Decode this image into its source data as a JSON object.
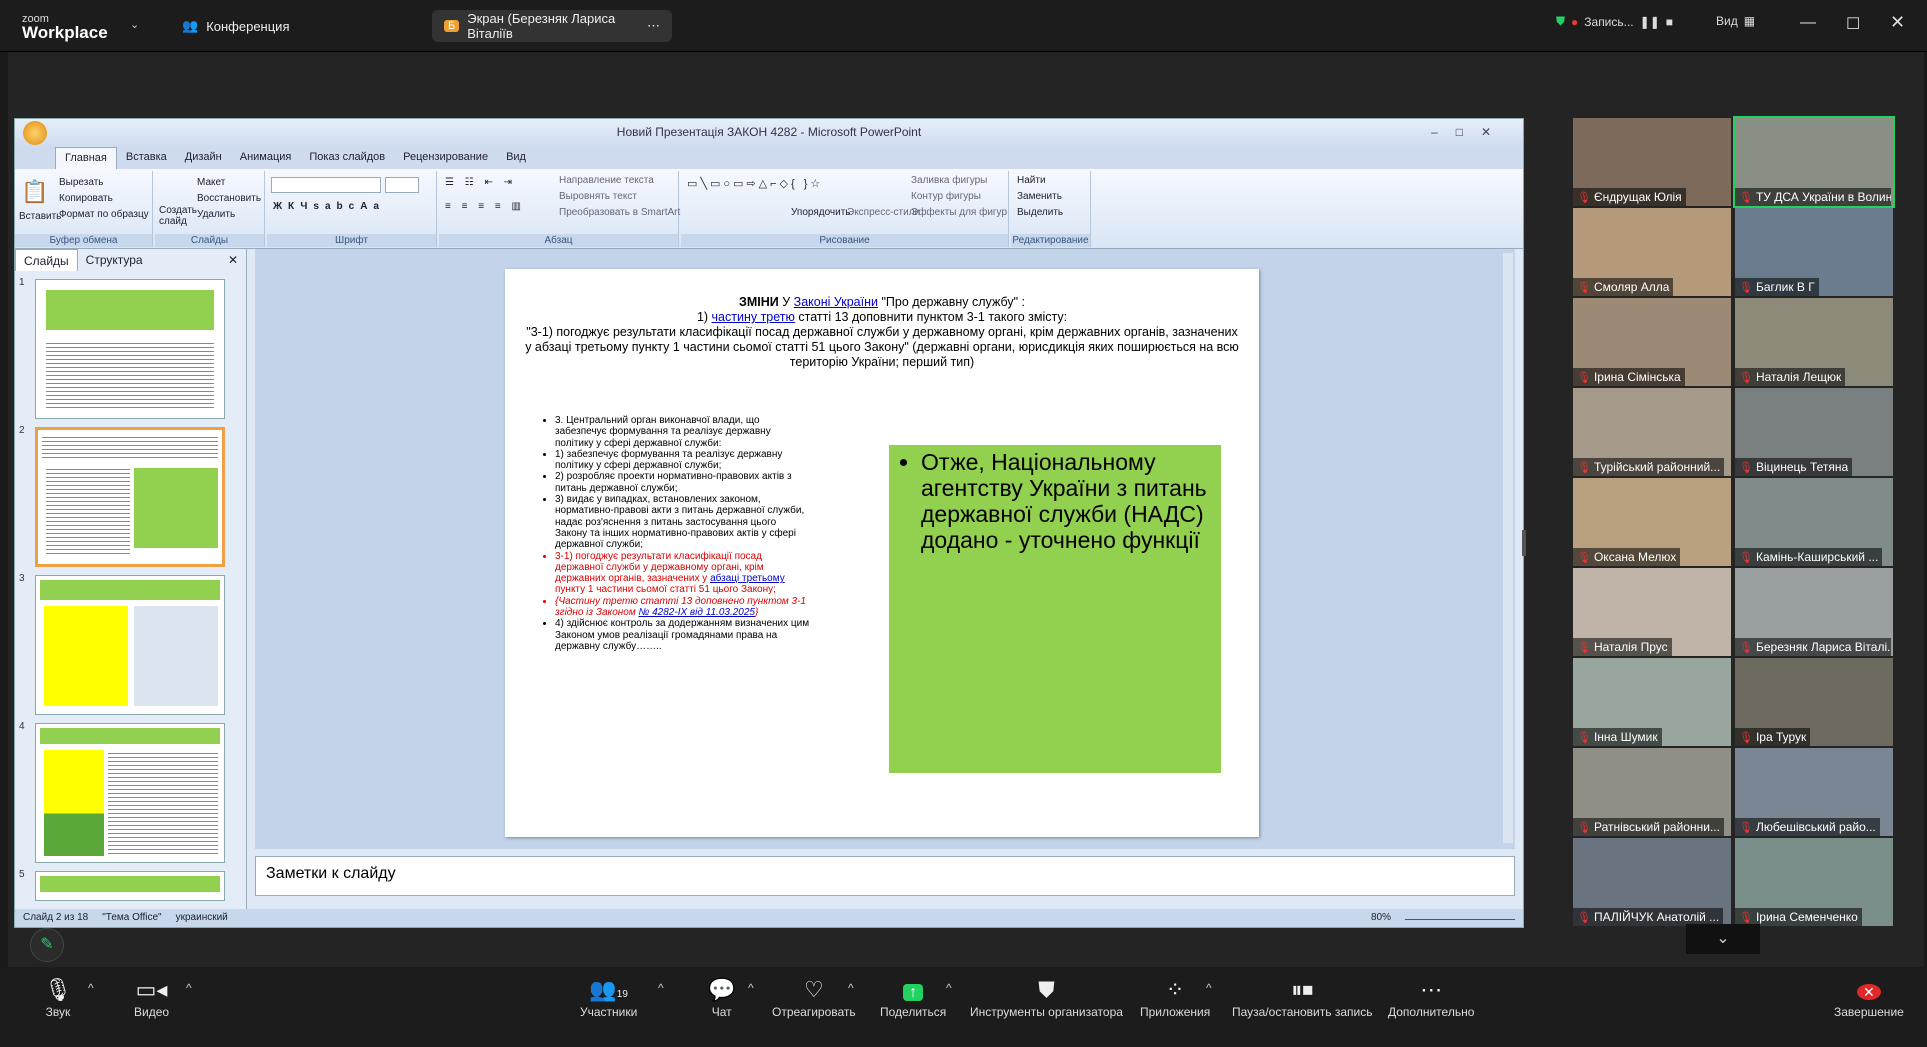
{
  "zoom": {
    "logo_top": "zoom",
    "logo_bottom": "Workplace",
    "tab_meeting": "Конференция",
    "tab_share": "Экран (Березняк Лариса Віталіїв",
    "share_badge": "Б",
    "recording": "Запись...",
    "view": "Вид"
  },
  "ppt": {
    "title": "Новий Презентація ЗАКОН 4282 - Microsoft PowerPoint",
    "tabs": [
      "Главная",
      "Вставка",
      "Дизайн",
      "Анимация",
      "Показ слайдов",
      "Рецензирование",
      "Вид"
    ],
    "ribbon": {
      "paste": "Вставить",
      "cut": "Вырезать",
      "copy": "Копировать",
      "format_painter": "Формат по образцу",
      "clipboard_cap": "Буфер обмена",
      "create_slide": "Создать слайд",
      "layout": "Макет",
      "reset": "Восстановить",
      "delete": "Удалить",
      "slides_cap": "Слайды",
      "font_cap": "Шрифт",
      "text_dir": "Направление текста",
      "align_text": "Выровнять текст",
      "smartart": "Преобразовать в SmartArt",
      "para_cap": "Абзац",
      "arrange": "Упорядочить",
      "quick_styles": "Экспресс-стили",
      "fill": "Заливка фигуры",
      "outline": "Контур фигуры",
      "effects": "Эффекты для фигур",
      "drawing_cap": "Рисование",
      "find": "Найти",
      "replace": "Заменить",
      "select": "Выделить",
      "editing_cap": "Редактирование"
    },
    "pane_tabs": [
      "Слайды",
      "Структура"
    ],
    "slide_numbers": [
      "1",
      "2",
      "3",
      "4",
      "5"
    ],
    "slide": {
      "header_bold": "ЗМІНИ",
      "header_pre": " У ",
      "header_link": "Законі України",
      "header_post": " \"Про державну службу\" :",
      "line2_pre": "1) ",
      "line2_link": "частину третю",
      "line2_post": " статті 13 доповнити пунктом 3-1 такого змісту:",
      "quote": "\"3-1) погоджує результати класифікації посад державної служби у державному органі, крім державних органів, зазначених у абзаці третьому пункту 1 частини сьомої статті 51 цього Закону\" (державні органи, юрисдикція яких поширюється на всю територію України; перший тип)",
      "bullets": [
        "3. Центральний орган виконавчої влади, що забезпечує формування та реалізує державну політику у сфері державної служби:",
        "1) забезпечує формування та реалізує державну політику у сфері державної служби;",
        "2) розробляє проекти нормативно-правових  актів з питань державної служби;",
        "3) видає у випадках, встановлених законом, нормативно-правові акти з питань державної служби, надає роз'яснення  з питань застосування цього Закону та інших нормативно-правових актів у сфері державної служби;"
      ],
      "red_bullet_pre": "3-1) погоджує результати класифікації посад державної служби у державному органі, крім державних органів, зазначених  у ",
      "red_bullet_link": "абзаці третьому",
      "red_bullet_post": " пункту 1 частини сьомої статті 51 цього Закону;",
      "italic_pre": "{Частину третю статті 13 доповнено пунктом 3-1 згідно із Законом ",
      "italic_link": "№ 4282-IX від 11.03.2025",
      "italic_post": "}",
      "last_bullet": "4) здійснює контроль за додержанням визначених цим Законом умов реалізації громадянами права на державну службу……..",
      "green_box": "Отже,  Національному агентству України з питань державної служби (НАДС) додано - уточнено  функції"
    },
    "notes_placeholder": "Заметки к слайду",
    "status_slide": "Слайд 2 из 18",
    "status_theme": "\"Тема Office\"",
    "status_lang": "украинский",
    "zoom_pct": "80%"
  },
  "participants": [
    "Єндрущак Юлія",
    "ТУ ДСА України в Волин...",
    "Смоляр Алла",
    "Баглик В Г",
    "Ірина Сімінська",
    "Наталія Лещюк",
    "Турійський районний...",
    "Віцинець Тетяна",
    "Оксана Мелюх",
    "Камінь-Каширський ...",
    "Наталія Прус",
    "Березняк Лариса Віталі...",
    "Інна Шумик",
    "Іра Турук",
    "Ратнівський районни...",
    "Любешівський райо...",
    "ПАЛІЙЧУК Анатолій ...",
    "Ірина Семенченко"
  ],
  "toolbar": {
    "audio": "Звук",
    "video": "Видео",
    "participants": "Участники",
    "participants_count": "19",
    "chat": "Чат",
    "react": "Отреагировать",
    "share": "Поделиться",
    "host_tools": "Инструменты организатора",
    "apps": "Приложения",
    "pause_rec": "Пауза/остановить запись",
    "more": "Дополнительно",
    "end": "Завершение"
  },
  "colors": {
    "accent_green": "#92d050",
    "slide_yellow": "#ffff00",
    "zoom_share_green": "#23d160"
  }
}
